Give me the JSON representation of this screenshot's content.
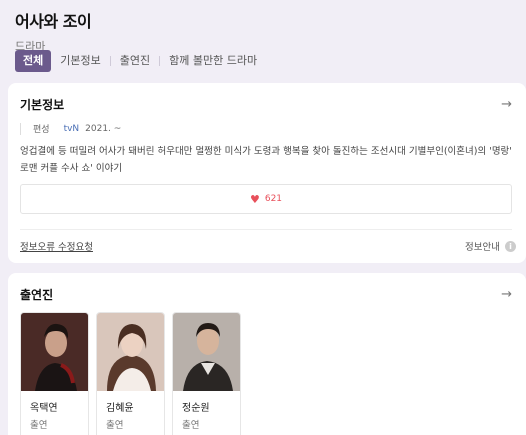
{
  "header": {
    "title": "어사와 조이",
    "subtitle": "드라마"
  },
  "tabs": [
    {
      "label": "전체",
      "active": true
    },
    {
      "label": "기본정보",
      "active": false
    },
    {
      "label": "출연진",
      "active": false
    },
    {
      "label": "함께 볼만한 드라마",
      "active": false
    }
  ],
  "basic_info": {
    "title": "기본정보",
    "genre": "편성",
    "network": "tvN",
    "date": "2021. ~",
    "description": "엉겁결에 등 떠밀려 어사가 돼버린 허우대만 멀쩡한 미식가 도령과 행복을 찾아 돌진하는 조선시대 기별부인(이혼녀)의 '명랑' 로맨 커플 수사 쇼' 이야기",
    "likes": "621",
    "report_link": "정보오류 수정요청",
    "info_link": "정보안내",
    "info_icon": "info-icon"
  },
  "cast_section": {
    "title": "출연진",
    "members": [
      {
        "name": "옥택연",
        "role": "출연"
      },
      {
        "name": "김혜윤",
        "role": "출연"
      },
      {
        "name": "정순원",
        "role": "출연"
      }
    ]
  },
  "colors": {
    "accent": "#6b5a8c",
    "background": "#f1eef6",
    "heart": "#e8505b",
    "network": "#4a6fb5"
  }
}
